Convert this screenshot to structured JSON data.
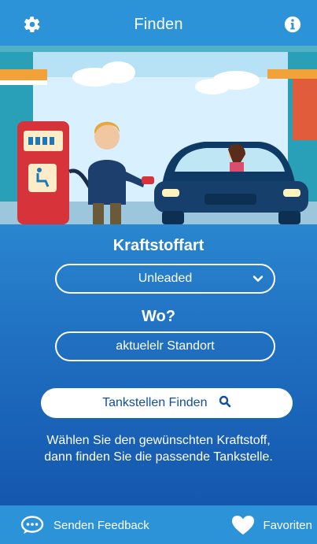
{
  "header": {
    "title": "Finden",
    "left_icon": "gear-icon",
    "right_icon": "info-icon"
  },
  "form": {
    "fuel_label": "Kraftstoffart",
    "fuel_value": "Unleaded",
    "where_label": "Wo?",
    "where_value": "aktuelelr Standort",
    "find_button": "Tankstellen Finden",
    "hint": "Wählen Sie den gewünschten Kraftstoff, dann finden Sie die passende Tankstelle."
  },
  "footer": {
    "feedback_label": "Senden Feedback",
    "favorites_label": "Favoriten"
  },
  "colors": {
    "header_bg": "#2d93d8",
    "panel_top": "#2a86cf",
    "panel_bottom": "#1457ae",
    "button_text": "#124ea3"
  }
}
